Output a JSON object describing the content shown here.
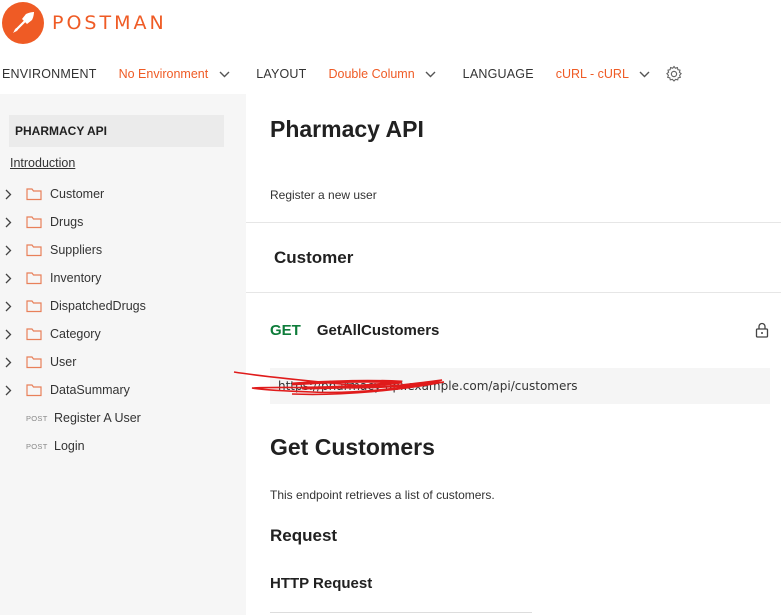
{
  "brand": {
    "name": "POSTMAN",
    "accent": "#ef5b25"
  },
  "toolbar": {
    "environment_label": "ENVIRONMENT",
    "environment_value": "No Environment",
    "layout_label": "LAYOUT",
    "layout_value": "Double Column",
    "language_label": "LANGUAGE",
    "language_value": "cURL - cURL"
  },
  "sidebar": {
    "collection_title": "PHARMACY API",
    "intro_link": "Introduction",
    "folders": [
      {
        "label": "Customer"
      },
      {
        "label": "Drugs"
      },
      {
        "label": "Suppliers"
      },
      {
        "label": "Inventory"
      },
      {
        "label": "DispatchedDrugs"
      },
      {
        "label": "Category"
      },
      {
        "label": "User"
      },
      {
        "label": "DataSummary"
      }
    ],
    "requests": [
      {
        "method": "POST",
        "label": "Register A User"
      },
      {
        "method": "POST",
        "label": "Login"
      }
    ]
  },
  "main": {
    "title": "Pharmacy API",
    "description": "Register a new user",
    "section": "Customer",
    "request": {
      "method": "GET",
      "name": "GetAllCustomers",
      "method_color": "#0e7c3a",
      "url": "https://pharmacy-api.example.com/api/customers"
    },
    "endpoint_title": "Get Customers",
    "endpoint_description": "This endpoint retrieves a list of customers.",
    "request_heading": "Request",
    "http_request_heading": "HTTP Request"
  }
}
